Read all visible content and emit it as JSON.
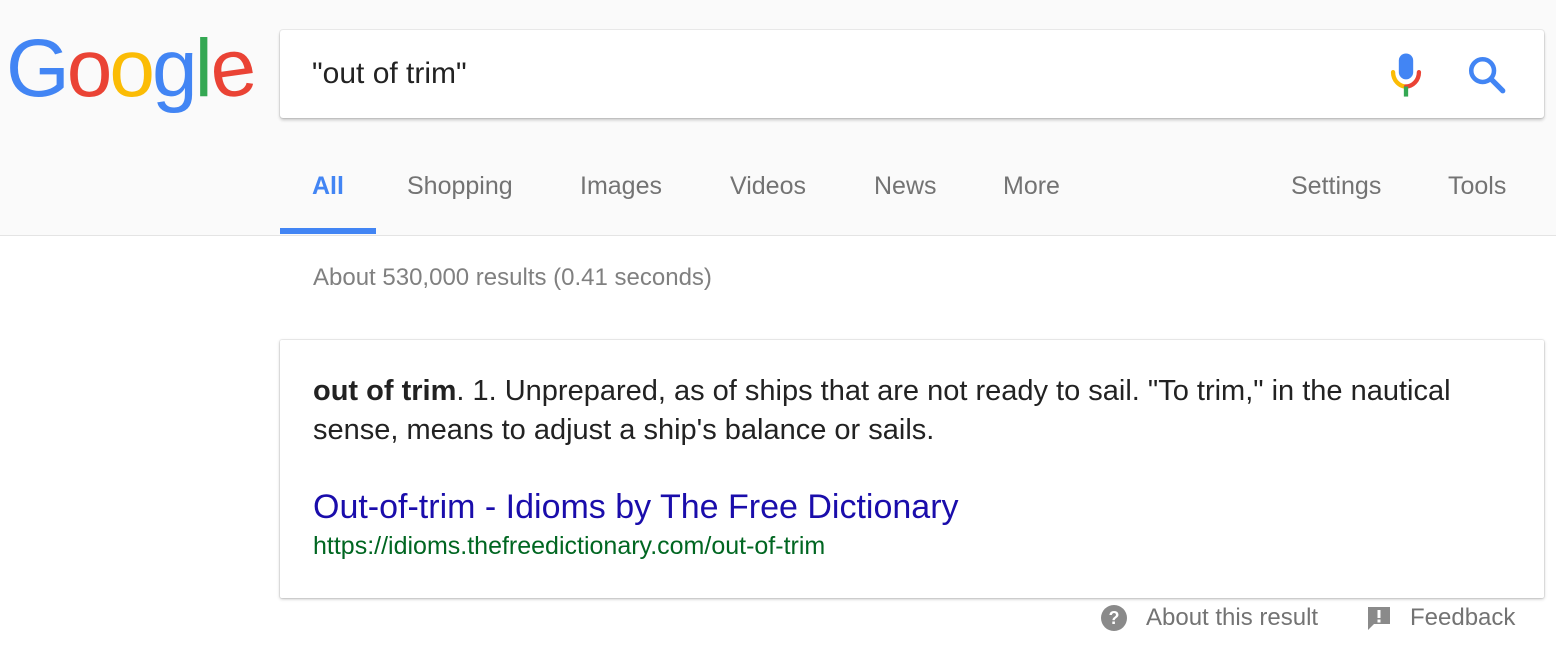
{
  "logo": {
    "text": [
      "G",
      "o",
      "o",
      "g",
      "l",
      "e"
    ],
    "colors": [
      "#4285F4",
      "#EA4335",
      "#FBBC05",
      "#4285F4",
      "#34A853",
      "#EA4335"
    ]
  },
  "search": {
    "query": "\"out of trim\""
  },
  "tabs": [
    {
      "label": "All",
      "active": true
    },
    {
      "label": "Shopping"
    },
    {
      "label": "Images"
    },
    {
      "label": "Videos"
    },
    {
      "label": "News"
    },
    {
      "label": "More"
    }
  ],
  "tools": {
    "settings": "Settings",
    "tools": "Tools"
  },
  "stats": "About 530,000 results (0.41 seconds)",
  "featured": {
    "term": "out of trim",
    "definition": ". 1. Unprepared, as of ships that are not ready to sail. \"To trim,\" in the nautical sense, means to adjust a ship's balance or sails.",
    "title": "Out-of-trim - Idioms by The Free Dictionary",
    "url": "https://idioms.thefreedictionary.com/out-of-trim"
  },
  "footer": {
    "about": "About this result",
    "feedback": "Feedback"
  },
  "colors": {
    "accent": "#4285f4",
    "link": "#1a0dab",
    "url": "#006621"
  }
}
